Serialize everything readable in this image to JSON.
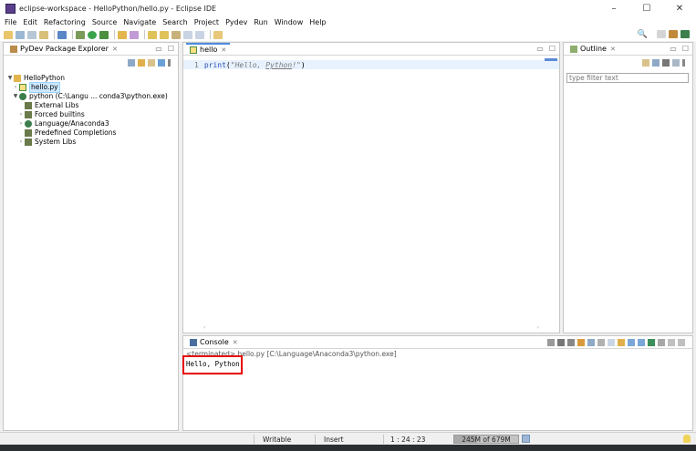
{
  "window": {
    "title": "eclipse-workspace - HelloPython/hello.py - Eclipse IDE",
    "controls": [
      "–",
      "☐",
      "✕"
    ]
  },
  "menu": [
    "File",
    "Edit",
    "Refactoring",
    "Source",
    "Navigate",
    "Search",
    "Project",
    "Pydev",
    "Run",
    "Window",
    "Help"
  ],
  "explorer": {
    "tab_label": "PyDev Package Explorer",
    "tree": {
      "project": "HelloPython",
      "file": "hello.py",
      "interpreter": "python  (C:\\Langu ... conda3\\python.exe)",
      "children": [
        "External Libs",
        "Forced builtins",
        "Language/Anaconda3",
        "Predefined Completions",
        "System Libs"
      ]
    }
  },
  "editor": {
    "tab_label": "hello",
    "line_number": "1",
    "code_keyword": "print",
    "code_open": "(",
    "code_string_pre": "\"Hello, ",
    "code_string_word": "Python",
    "code_string_post": "!\"",
    "code_close": ")"
  },
  "outline": {
    "tab_label": "Outline",
    "filter_placeholder": "type filter text"
  },
  "console": {
    "tab_label": "Console",
    "description": "<terminated> hello.py [C:\\Language\\Anaconda3\\python.exe]",
    "output": "Hello, Python!"
  },
  "status": {
    "writable": "Writable",
    "insert_mode": "Insert",
    "position": "1 : 24 : 23",
    "heap_text": "245M of 679M",
    "heap_used_mb": 245,
    "heap_total_mb": 679
  },
  "colors": {
    "accent": "#4c8be0",
    "highlight": "#e60000",
    "selection": "#cde8ff"
  }
}
